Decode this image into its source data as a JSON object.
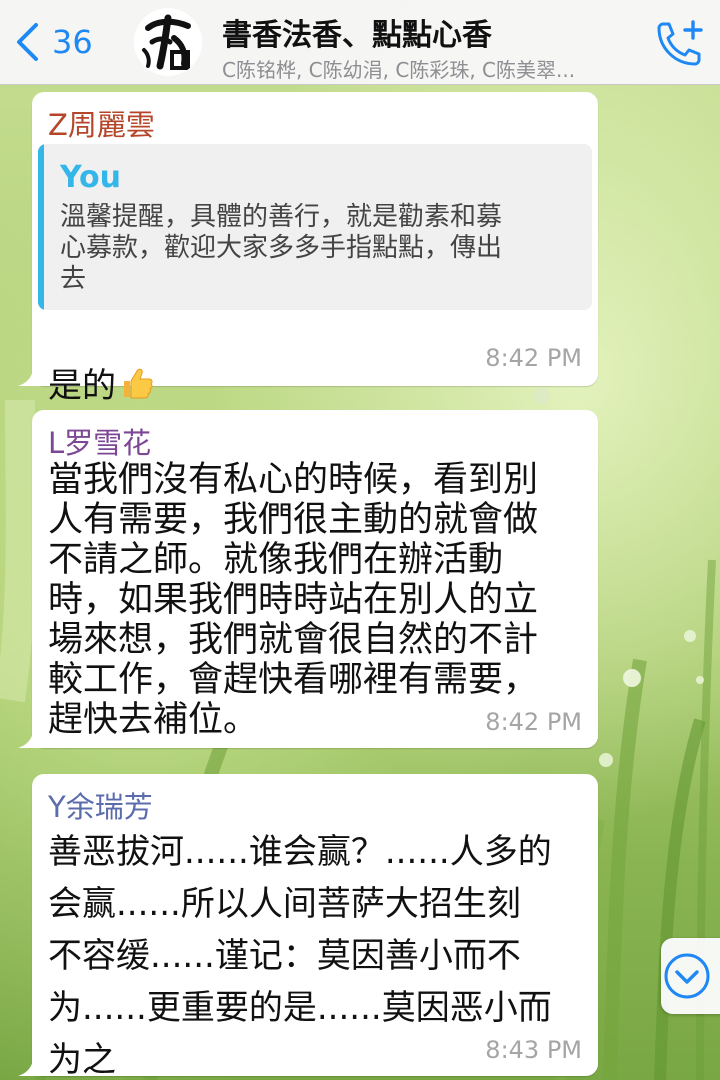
{
  "header": {
    "back_count": "36",
    "title": "書香法香、點點心香",
    "subtitle": "C陈铭桦, C陈幼涓, C陈彩珠, C陈美翠..."
  },
  "messages": [
    {
      "sender": "Z周麗雲",
      "sender_color": "#b5462a",
      "quote": {
        "author": "You",
        "text": "溫馨提醒，具體的善行，就是勸素和募\n心募款，歡迎大家多多手指點點，傳出\n去"
      },
      "text": "是的",
      "emoji": "thumbs-up",
      "time": "8:42 PM"
    },
    {
      "sender": "L罗雪花",
      "sender_color": "#7c4896",
      "text": "當我們沒有私心的時候，看到別\n人有需要，我們很主動的就會做\n不請之師。就像我們在辦活動\n時，如果我們時時站在別人的立\n場來想，我們就會很自然的不計\n較工作，會趕快看哪裡有需要，\n趕快去補位。",
      "time": "8:42 PM"
    },
    {
      "sender": "Y余瑞芳",
      "sender_color": "#5b6cac",
      "text": "善恶拔河......谁会赢？......人多的\n会赢......所以人间菩萨大招生刻\n不容缓......谨记：莫因善小而不\n为......更重要的是......莫因恶小而\n为之",
      "time": "8:43 PM"
    }
  ],
  "icons": {
    "back": "chevron-left-icon",
    "call": "phone-plus-icon",
    "scroll": "chevron-down-circle-icon"
  },
  "colors": {
    "accent": "#1e88f5",
    "quote_bar": "#35b6e9"
  }
}
